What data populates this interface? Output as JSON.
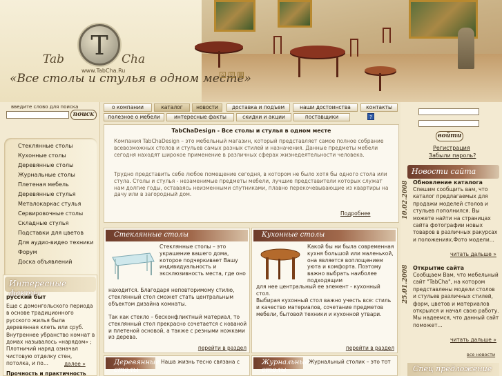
{
  "header": {
    "logo_letter": "T",
    "logo_left": "Tab",
    "logo_right": "Cha",
    "url": "www.TabCha.Ru",
    "slogan": "«Все столы и стулья в одном месте»",
    "icons": [
      "home-icon",
      "mail-icon",
      "sitemap-icon"
    ]
  },
  "search": {
    "label": "введите слово для поиска",
    "value": "",
    "button": "поиск"
  },
  "catalog": {
    "items": [
      "Стеклянные столы",
      "Кухонные столы",
      "Деревянные столы",
      "Журнальные столы",
      "Плетеная мебель",
      "Деревянные стулья",
      "Металокаркас стулья",
      "Сервировочные столы",
      "Складные стулья",
      "Подставки для цветов",
      "Для аудио-видео техники",
      "Форум",
      "Доска объявлений"
    ]
  },
  "facts": {
    "title": "Интересные факты",
    "subtitle": "русский быт",
    "text": "Еще с домонгольского периода в основе традиционного русского жилья была деревянная клеть или сруб. Внутреннее убранство комнат в домах называлось «нарядом» ; Плотничий наряд означал чистовую отделку стен, потолка, и по...",
    "more": "далее »",
    "tail": "Прочность и практичность"
  },
  "nav": {
    "row1": [
      "о компании",
      "каталог",
      "новости",
      "доставка и подъем",
      "наши достоинства",
      "контакты"
    ],
    "row2": [
      "полезное о мебели",
      "интересные факты",
      "скидки и акции",
      "поставщики"
    ],
    "icon": "help-icon"
  },
  "intro": {
    "title": "TabChaDesign - Все столы и стулья в одном месте",
    "p1": "Компания TabChaDesign – это мебельный магазин, который представляет самое полное собрание всевозможных столов и стульев самых разных стилей и назначения. Данные предметы мебели сегодня находят широкое применение в различных сферах жизнедеятельности человека.",
    "p2": "Трудно представить себе любое помещение сегодня, в котором не было хотя бы одного стола или стула. Столы и стулья - незаменимые предметы мебели, лучшие представители которых служат нам долгие годы, оставаясь неизменными спутниками, плавно перекочевывающие из квартиры на дачу или в загородный дом.",
    "more": "Подробнее"
  },
  "sections": [
    {
      "title": "Стеклянные столы",
      "text_top": "Стеклянные столы – это украшение вашего дома, которое подчеркивает Вашу индивидуальность и эксклюзивность места, где оно",
      "text_bottom": "находится. Благодаря неповторимому стилю, стеклянный стол сможет стать центральным объектом дизайна комнаты.",
      "text_more": "Так как стекло – бесконфликтный материал, то стеклянный стол прекрасно сочетается с кованой и плетеной основой, а также с резными ножками из дерева.",
      "more": "перейти в раздел"
    },
    {
      "title": "Кухонные столы",
      "text_top": "Какой бы ни была современная кухня большой или маленькой, она является воплощением уюта и комфорта. Поэтому важно выбрать наиболее подходящим",
      "text_bottom": "для нее центральный ее элемент - кухонный стол.",
      "text_more": "Выбирая кухонный стол важно учесть все: стиль и качество материалов, сочетание предметов мебели, бытовой техники и кухонной утвари.",
      "more": "перейти в раздел"
    }
  ],
  "sections2": [
    {
      "title": "Деревянные столы",
      "text": "Наша жизнь тесно связана с"
    },
    {
      "title": "Журнальные столы",
      "text": "Журнальный столик – это тот"
    }
  ],
  "login": {
    "login_value": "",
    "password_value": "",
    "button": "войти",
    "register": "Регистрация",
    "forgot": "Забыли пароль?"
  },
  "news": {
    "title": "Новости сайта",
    "items": [
      {
        "date": "10.02.2008",
        "head": "Обновление каталога",
        "body": "Спешим сообщить вам, что каталог предлагаемых для продажи моделей столов и стульев пополнился. Вы можете найти на страницах сайта фотографии новых товаров в различных ракурсах и положениях.Фото модели...",
        "more": "читать дальше »"
      },
      {
        "date": "25.01.2008",
        "head": "Открытие сайта",
        "body": "Сообщаем Вам, что мебельный сайт \"TabCha\", на котором представлены модели столов и стульев различных стилей, форм, цветов и материалов открылся и начал свою работу. Мы надеемся, что данный сайт поможет...",
        "more": "читать дальше »"
      }
    ],
    "all": "все новости",
    "spec_title": "Спец предложение"
  },
  "colors": {
    "accent_brown": "#6e3c2b",
    "background": "#efe6cc",
    "nav_icon": "#2f5aa4"
  }
}
